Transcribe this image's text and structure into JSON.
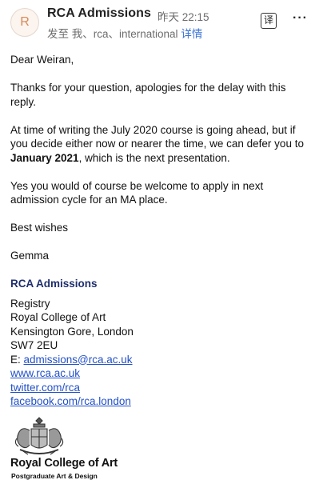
{
  "header": {
    "avatar_letter": "R",
    "sender": "RCA Admissions",
    "time": "昨天 22:15",
    "recipients_text": "发至 我、rca、international",
    "details_link": "详情",
    "translate_icon": "译",
    "more_icon": "···"
  },
  "email": {
    "greeting": "Dear Weiran,",
    "para1": "Thanks for your question, apologies for the delay with this reply.",
    "para2_before": "At time of writing the July 2020 course is going ahead, but if you decide either now or nearer the time, we can defer you to ",
    "para2_bold": "January 2021",
    "para2_after": ", which is the next presentation.",
    "para3": "Yes you would of course be welcome to apply in next admission cycle for an MA place.",
    "signoff": "Best wishes",
    "name": "Gemma"
  },
  "signature": {
    "title": "RCA Admissions",
    "line1": "Registry",
    "line2": "Royal College of Art",
    "line3": "Kensington Gore, London",
    "line4": "SW7 2EU",
    "email_prefix": "E: ",
    "email": "admissions@rca.ac.uk",
    "website": "www.rca.ac.uk",
    "twitter": "twitter.com/rca",
    "facebook": "facebook.com/rca.london"
  },
  "logo": {
    "name": "Royal College of Art",
    "subtitle": "Postgraduate Art & Design"
  }
}
